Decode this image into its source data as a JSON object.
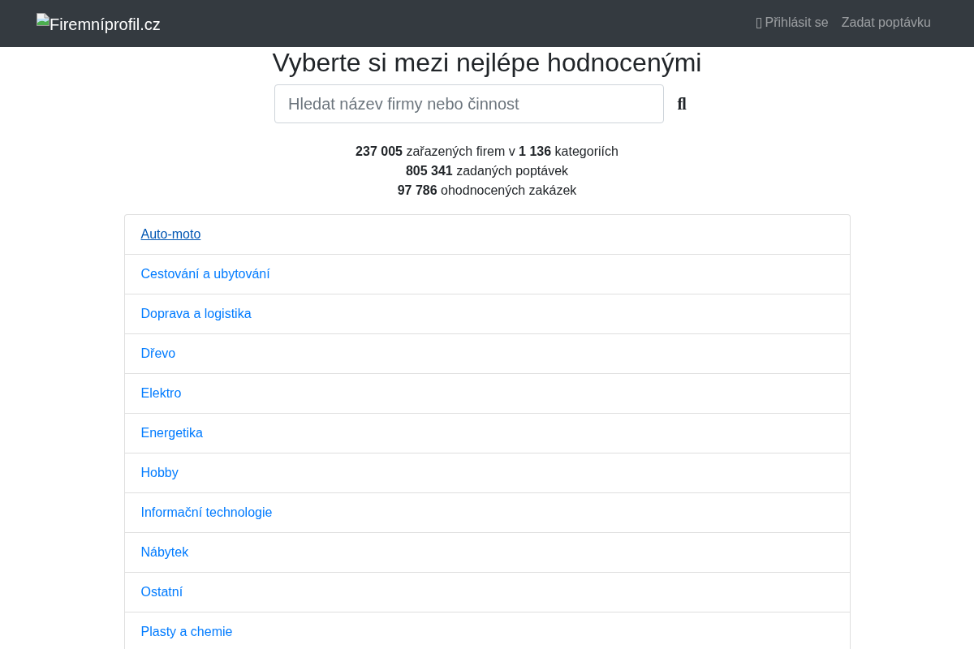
{
  "navbar": {
    "logo_text": "Firemníprofil.cz",
    "links": [
      {
        "label": "Přihlásit se",
        "icon": true
      },
      {
        "label": "Zadat poptávku",
        "icon": false
      }
    ]
  },
  "heading": "Vyberte si mezi nejlépe hodnocenými",
  "search": {
    "placeholder": "Hledat název firmy nebo činnost",
    "button_label": "ﬂ"
  },
  "stats": [
    "**237 005** zařazených firem v **1 136** kategoriích",
    "**805 341** zadaných poptávek",
    "**97 786** ohodnocených zakázek"
  ],
  "categories": [
    {
      "label": "Auto-moto",
      "hovered": true
    },
    {
      "label": "Cestování a ubytování",
      "hovered": false
    },
    {
      "label": "Doprava a logistika",
      "hovered": false
    },
    {
      "label": "Dřevo",
      "hovered": false
    },
    {
      "label": "Elektro",
      "hovered": false
    },
    {
      "label": "Energetika",
      "hovered": false
    },
    {
      "label": "Hobby",
      "hovered": false
    },
    {
      "label": "Informační technologie",
      "hovered": false
    },
    {
      "label": "Nábytek",
      "hovered": false
    },
    {
      "label": "Ostatní",
      "hovered": false
    },
    {
      "label": "Plasty a chemie",
      "hovered": false
    }
  ]
}
